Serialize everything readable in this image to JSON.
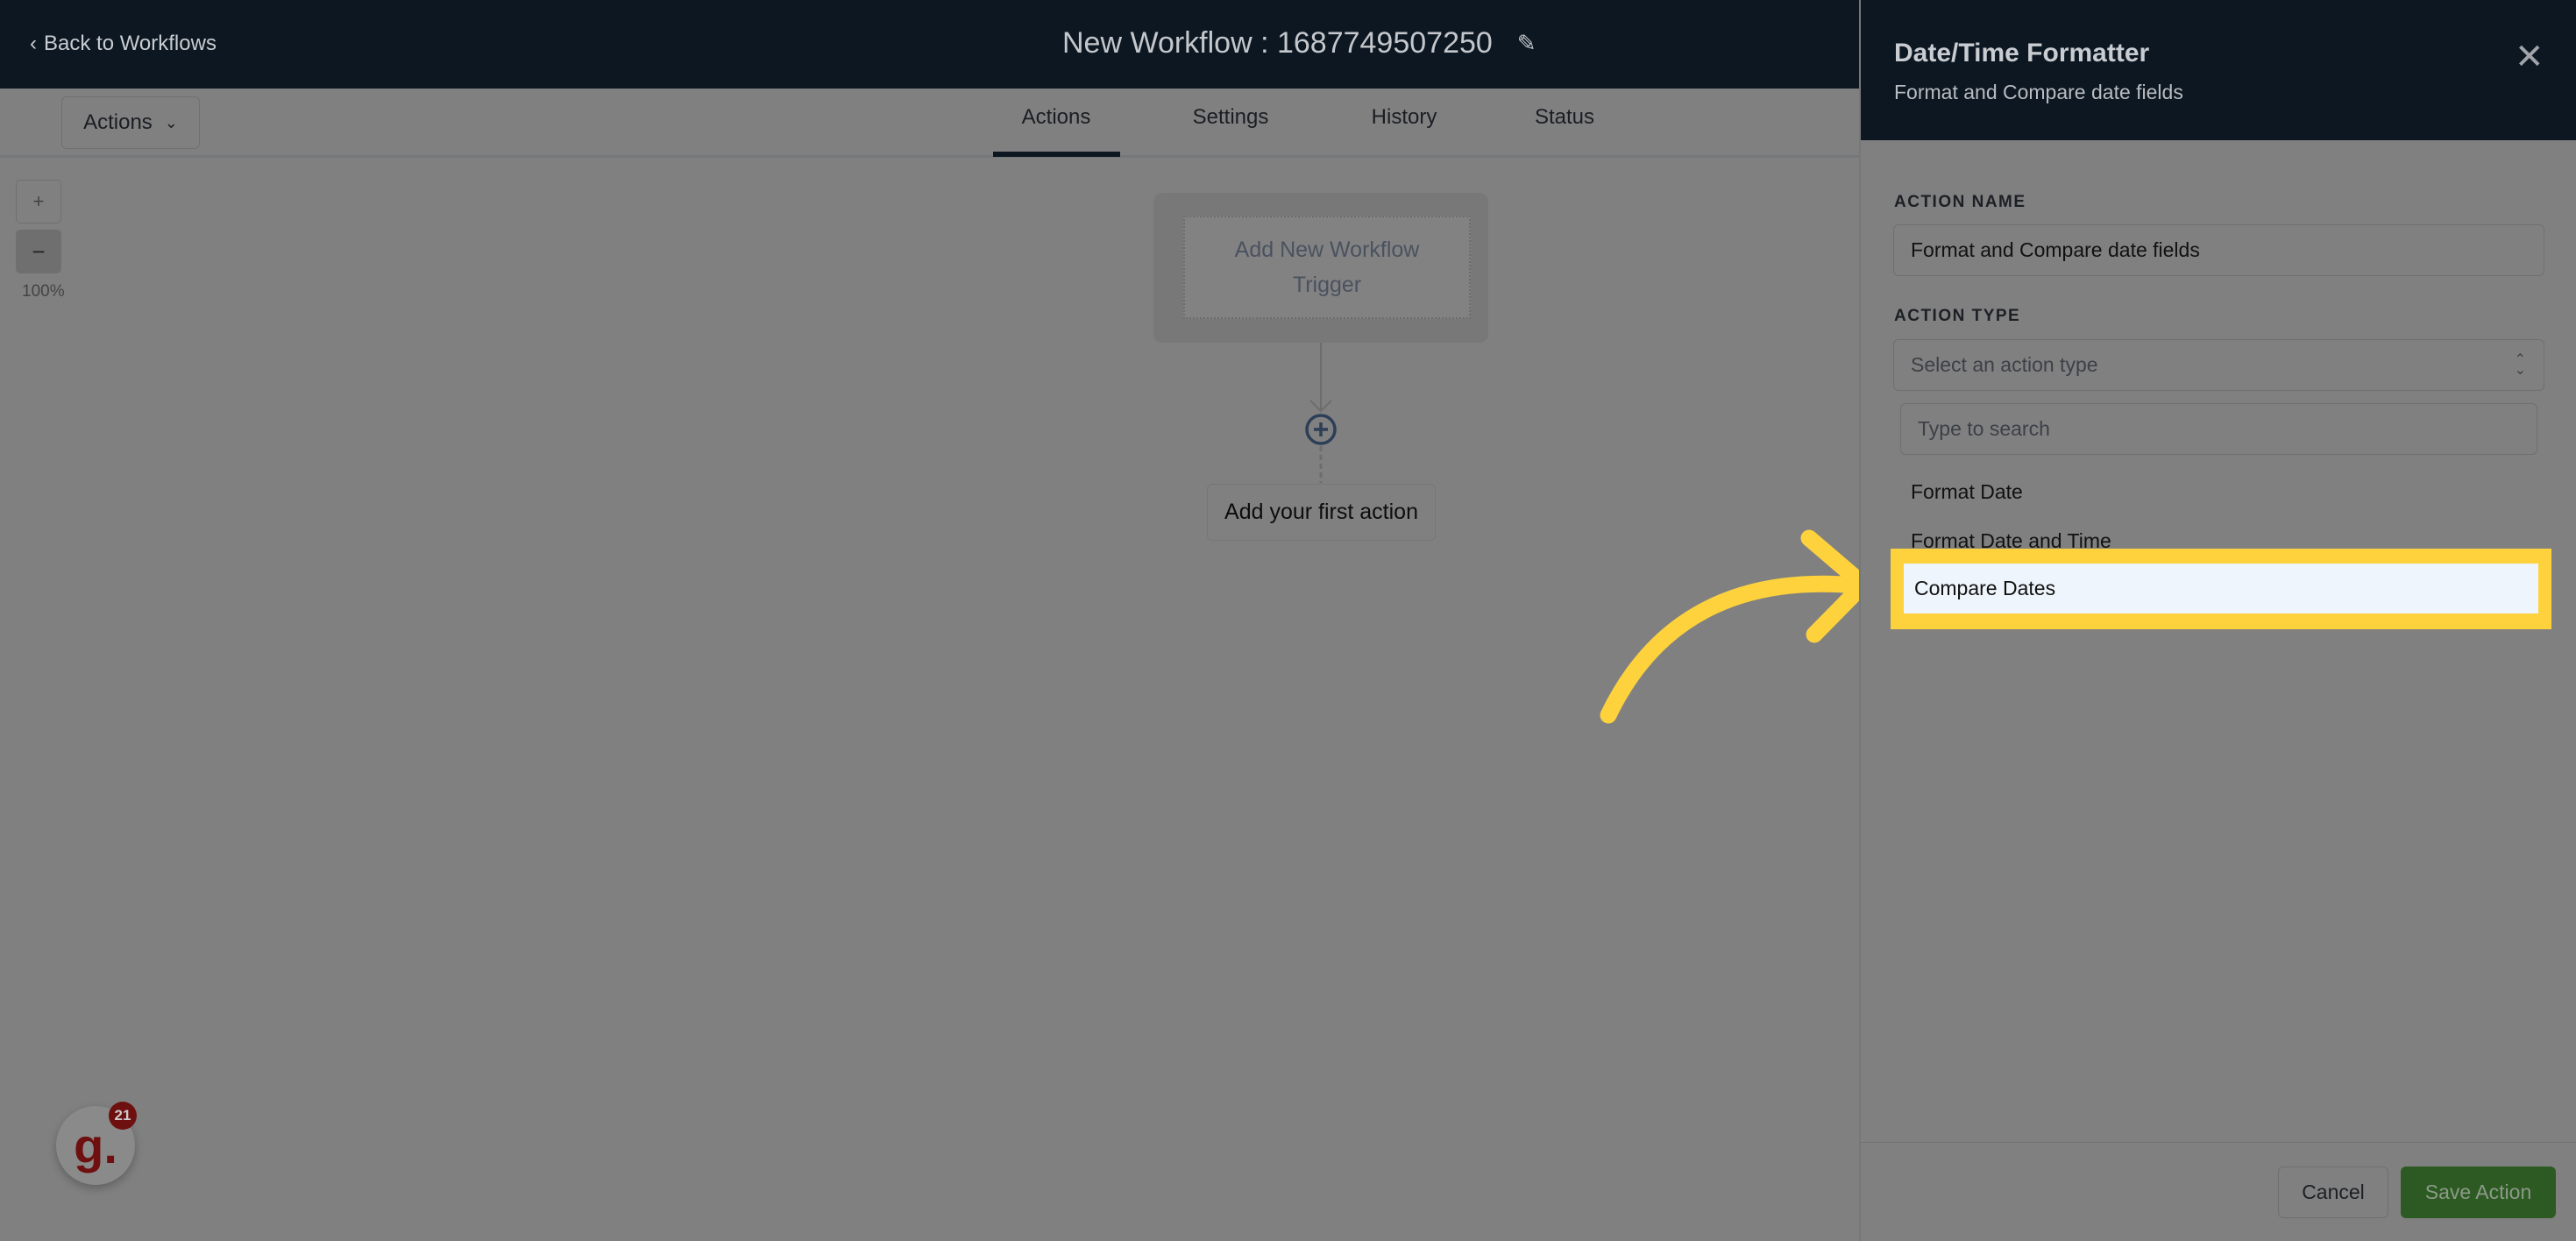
{
  "header": {
    "back_label": "Back to Workflows",
    "title": "New Workflow : 1687749507250"
  },
  "toolbar": {
    "actions_dropdown": "Actions",
    "tabs": [
      {
        "label": "Actions",
        "active": true
      },
      {
        "label": "Settings"
      },
      {
        "label": "History"
      },
      {
        "label": "Status"
      }
    ]
  },
  "canvas": {
    "zoom_in": "+",
    "zoom_out": "−",
    "zoom_level": "100%",
    "trigger_label": "Add New Workflow Trigger",
    "first_action": "Add your first action"
  },
  "panel": {
    "title": "Date/Time Formatter",
    "subtitle": "Format and Compare date fields",
    "action_name_label": "ACTION NAME",
    "action_name_value": "Format and Compare date fields",
    "action_type_label": "ACTION TYPE",
    "action_type_placeholder": "Select an action type",
    "search_placeholder": "Type to search",
    "options": [
      "Format Date",
      "Format Date and Time",
      "Compare Dates"
    ],
    "highlighted_option": "Compare Dates",
    "cancel": "Cancel",
    "save": "Save Action"
  },
  "widget": {
    "logo": "g.",
    "badge_count": "21"
  },
  "colors": {
    "header": "#0c1722",
    "highlight": "#fdd23d",
    "save": "#2d5a22"
  }
}
